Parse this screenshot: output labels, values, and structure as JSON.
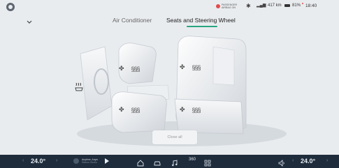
{
  "status_bar": {
    "airbag_text": "PASSENGER AIRBAG ON",
    "range": "417 km",
    "battery": "81%",
    "time": "18:40"
  },
  "tabs": [
    {
      "label": "Air Conditioner",
      "active": false
    },
    {
      "label": "Seats and Steering Wheel",
      "active": true
    }
  ],
  "close_all_label": "Close all",
  "dock": {
    "left_temp": "24.0°",
    "right_temp": "24.0°",
    "song_title": "Anytime, Anyw",
    "song_subtitle": "Station Studio",
    "cam_label": "360"
  },
  "colors": {
    "accent": "#2aa57d",
    "dock_bg": "#1f2c3c",
    "alert": "#e24b4b"
  }
}
